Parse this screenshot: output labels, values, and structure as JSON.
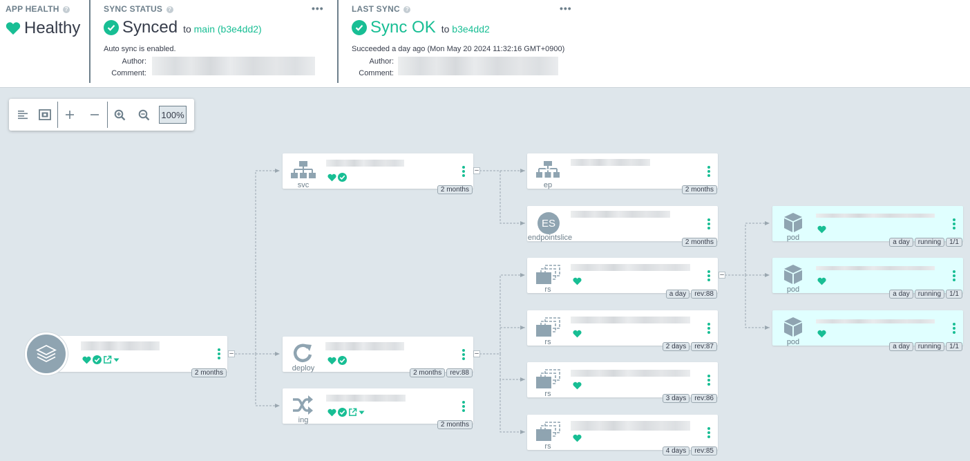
{
  "app_health": {
    "title": "APP HEALTH",
    "status": "Healthy"
  },
  "sync_status": {
    "title": "SYNC STATUS",
    "status": "Synced",
    "to_prefix": "to",
    "target": "main (b3e4dd2)",
    "auto_sync": "Auto sync is enabled.",
    "author_label": "Author:",
    "comment_label": "Comment:"
  },
  "last_sync": {
    "title": "LAST SYNC",
    "status": "Sync OK",
    "to_prefix": "to",
    "target": "b3e4dd2",
    "detail": "Succeeded a day ago (Mon May 20 2024 11:32:16 GMT+0900)",
    "author_label": "Author:",
    "comment_label": "Comment:"
  },
  "toolbar": {
    "zoom": "100%"
  },
  "colors": {
    "healthy": "#18be94",
    "graph_bg": "#dee6eb",
    "pod_bg": "#e0ffff",
    "icon_gray": "#8fa4b1"
  },
  "nodes": {
    "root": {
      "tags": [
        "2 months"
      ]
    },
    "svc": {
      "kind": "svc",
      "tags": [
        "2 months"
      ]
    },
    "deploy": {
      "kind": "deploy",
      "tags": [
        "2 months",
        "rev:88"
      ]
    },
    "ing": {
      "kind": "ing",
      "tags": [
        "2 months"
      ]
    },
    "ep": {
      "kind": "ep",
      "tags": [
        "2 months"
      ]
    },
    "eps": {
      "kind": "endpointslice",
      "icon_text": "ES",
      "tags": [
        "2 months"
      ]
    },
    "rs1": {
      "kind": "rs",
      "tags": [
        "a day",
        "rev:88"
      ]
    },
    "rs2": {
      "kind": "rs",
      "tags": [
        "2 days",
        "rev:87"
      ]
    },
    "rs3": {
      "kind": "rs",
      "tags": [
        "3 days",
        "rev:86"
      ]
    },
    "rs4": {
      "kind": "rs",
      "tags": [
        "4 days",
        "rev:85"
      ]
    },
    "pod1": {
      "kind": "pod",
      "tags": [
        "a day",
        "running",
        "1/1"
      ]
    },
    "pod2": {
      "kind": "pod",
      "tags": [
        "a day",
        "running",
        "1/1"
      ]
    },
    "pod3": {
      "kind": "pod",
      "tags": [
        "a day",
        "running",
        "1/1"
      ]
    }
  }
}
